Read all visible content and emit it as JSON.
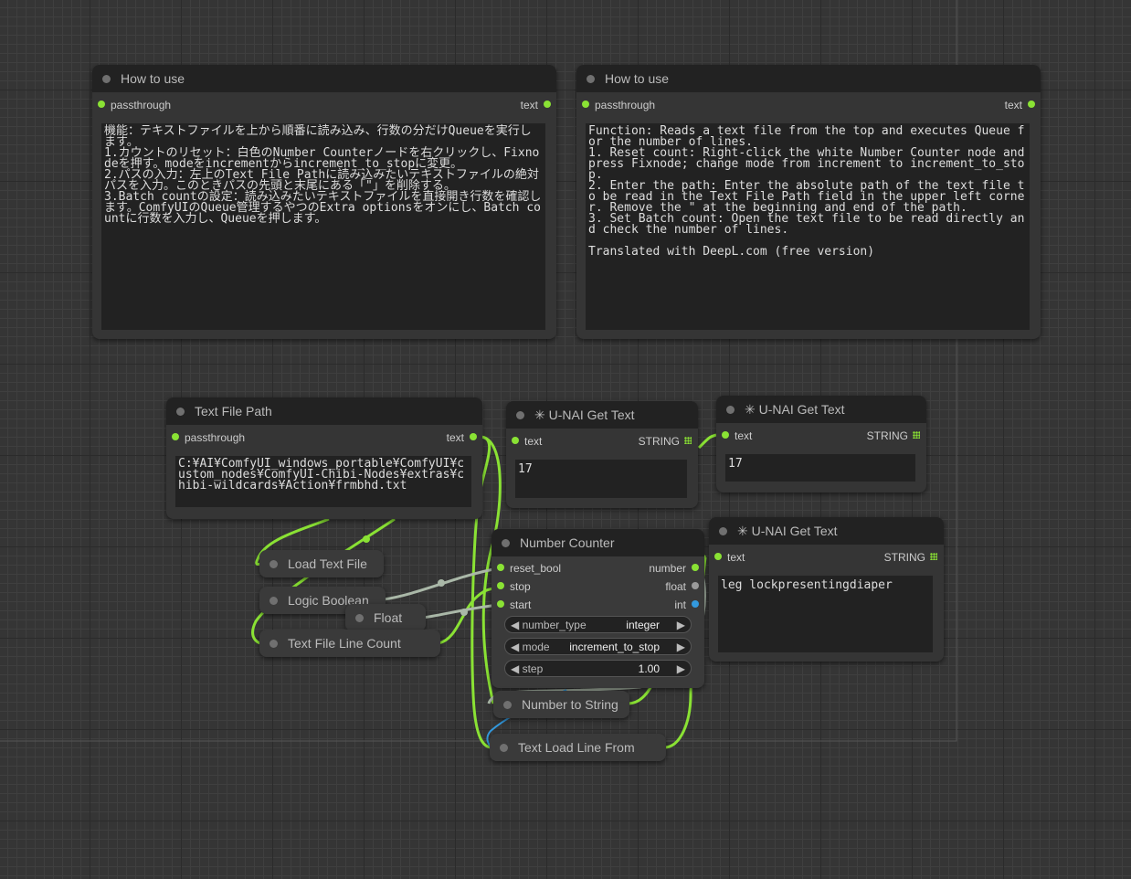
{
  "nodes": {
    "how_to_use_jp": {
      "title": "How to use",
      "input_label": "passthrough",
      "output_label": "text",
      "text": "機能：テキストファイルを上から順番に読み込み、行数の分だけQueueを実行します。\n1.カウントのリセット：白色のNumber Counterノードを右クリックし、Fixnodeを押す。modeをincrementからincrement_to_stopに変更。\n2.パスの入力：左上のText File Pathに読み込みたいテキストファイルの絶対パスを入力。このときパスの先頭と末尾にある「\"」を削除する。\n3.Batch countの設定：読み込みたいテキストファイルを直接開き行数を確認します。ComfyUIのQueue管理するやつのExtra optionsをオンにし、Batch countに行数を入力し、Queueを押します。"
    },
    "how_to_use_en": {
      "title": "How to use",
      "input_label": "passthrough",
      "output_label": "text",
      "text": "Function: Reads a text file from the top and executes Queue for the number of lines.\n1. Reset count: Right-click the white Number Counter node and press Fixnode; change mode from increment to increment_to_stop.\n2. Enter the path: Enter the absolute path of the text file to be read in the Text File Path field in the upper left corner. Remove the \" at the beginning and end of the path.\n3. Set Batch count: Open the text file to be read directly and check the number of lines.\n\nTranslated with DeepL.com (free version)"
    },
    "text_file_path": {
      "title": "Text File Path",
      "input_label": "passthrough",
      "output_label": "text",
      "text": "C:¥AI¥ComfyUI_windows_portable¥ComfyUI¥custom_nodes¥ComfyUI-Chibi-Nodes¥extras¥chibi-wildcards¥Action¥frmbhd.txt"
    },
    "get_text_1": {
      "title": "✳ U-NAI Get Text",
      "input_label": "text",
      "output_label": "STRING",
      "value": "17"
    },
    "get_text_2": {
      "title": "✳ U-NAI Get Text",
      "input_label": "text",
      "output_label": "STRING",
      "value": "17"
    },
    "get_text_3": {
      "title": "✳ U-NAI Get Text",
      "input_label": "text",
      "output_label": "STRING",
      "value": "leg lockpresentingdiaper"
    },
    "number_counter": {
      "title": "Number Counter",
      "inputs": [
        "reset_bool",
        "stop",
        "start"
      ],
      "outputs": [
        "number",
        "float",
        "int"
      ],
      "widgets": [
        {
          "label": "number_type",
          "value": "integer"
        },
        {
          "label": "mode",
          "value": "increment_to_stop"
        },
        {
          "label": "step",
          "value": "1.00"
        }
      ]
    },
    "collapsed": {
      "load_text_file": "Load Text File",
      "logic_boolean": "Logic Boolean",
      "float": "Float",
      "text_file_line_count": "Text File Line Count",
      "number_to_string": "Number to String",
      "text_load_line_from": "Text Load Line From"
    }
  },
  "colors": {
    "string_wire": "#8ae234",
    "number_wire": "#9cb39a",
    "int_wire": "#3399dd"
  }
}
